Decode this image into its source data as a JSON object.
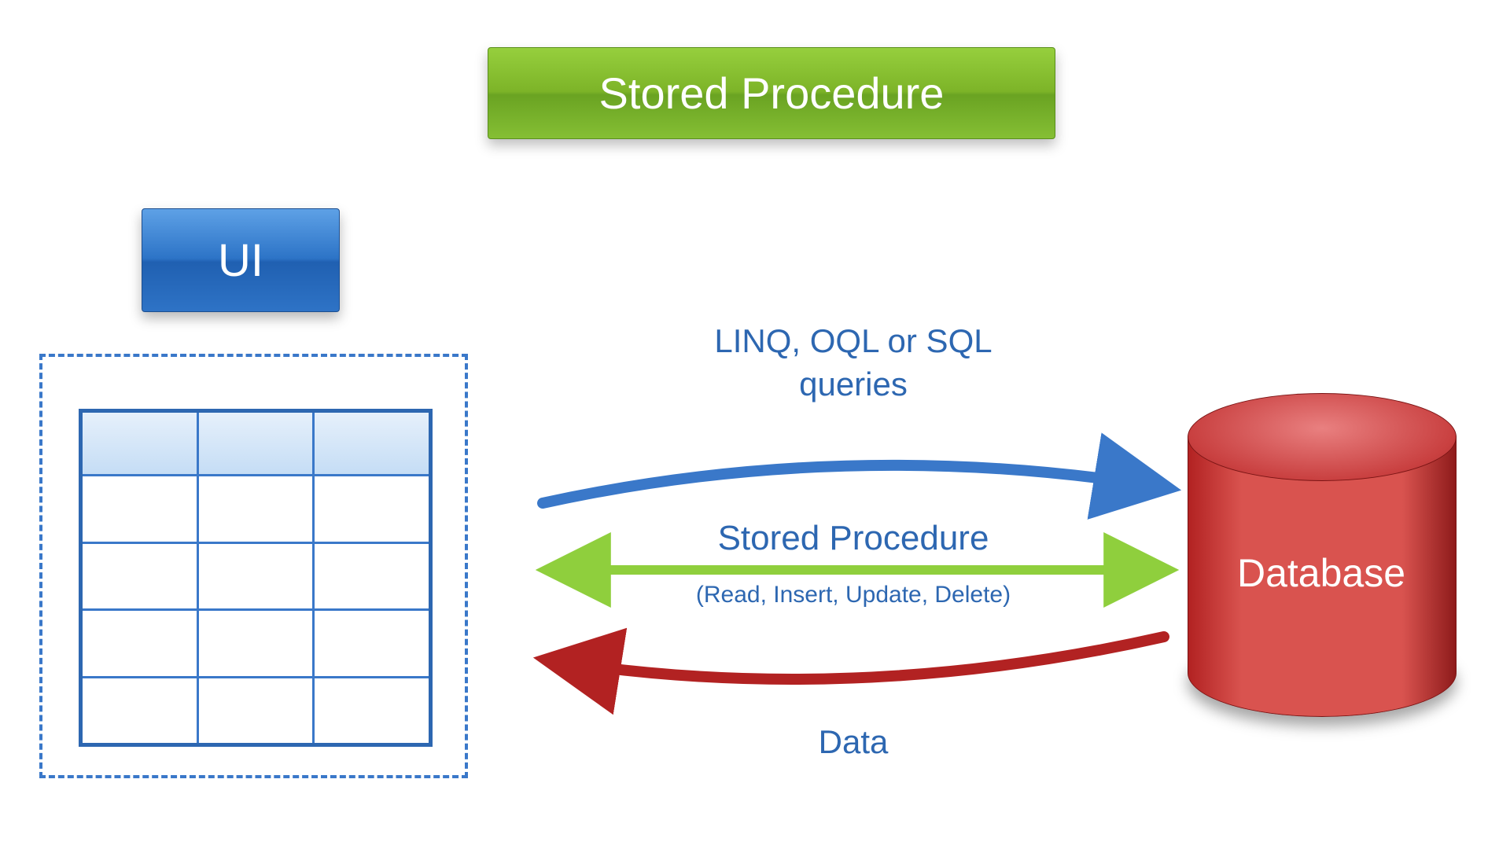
{
  "title": "Stored Procedure",
  "ui_label": "UI",
  "database_label": "Database",
  "arrows": {
    "queries_line1": "LINQ, OQL or SQL",
    "queries_line2": "queries",
    "stored_procedure": "Stored Procedure",
    "stored_procedure_sub": "(Read, Insert, Update, Delete)",
    "data": "Data"
  },
  "colors": {
    "title_bg": "#7db428",
    "ui_bg": "#2d74c7",
    "query_arrow": "#3a78c9",
    "sp_arrow": "#8fcf3d",
    "data_arrow": "#b22222",
    "database": "#c94040",
    "text": "#2d67b1"
  },
  "grid": {
    "columns": 3,
    "header_rows": 1,
    "body_rows": 4
  }
}
